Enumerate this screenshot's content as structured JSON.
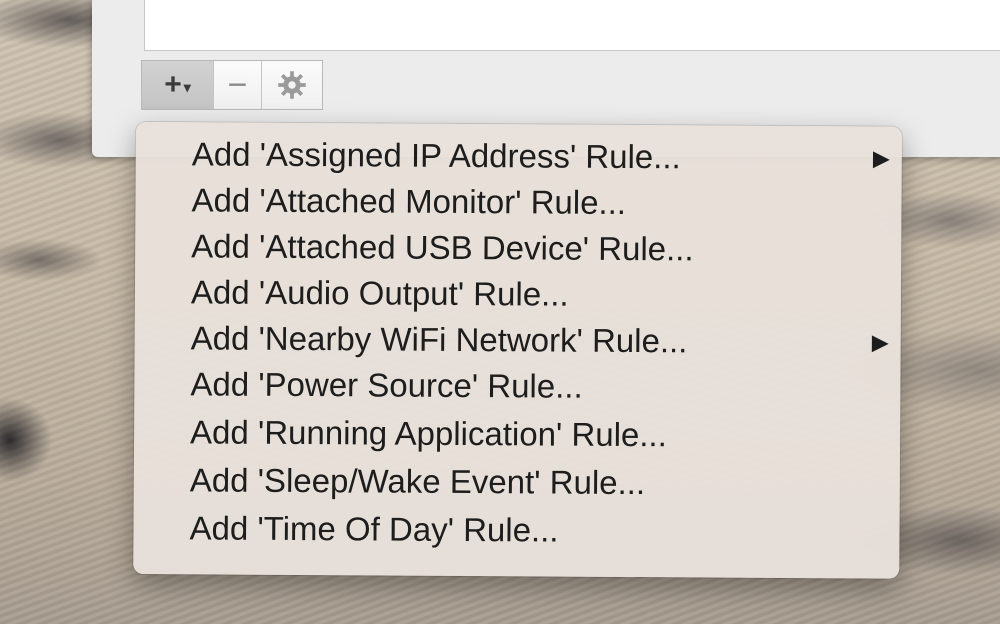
{
  "toolbar": {
    "add_label": "+",
    "add_caret": "▾",
    "remove_label": "−",
    "gear_icon": "gear-icon"
  },
  "menu": {
    "items": [
      {
        "label": "Add 'Assigned IP Address' Rule...",
        "submenu": true
      },
      {
        "label": "Add 'Attached Monitor' Rule...",
        "submenu": false
      },
      {
        "label": "Add 'Attached USB Device' Rule...",
        "submenu": false
      },
      {
        "label": "Add 'Audio Output' Rule...",
        "submenu": false
      },
      {
        "label": "Add 'Nearby WiFi Network' Rule...",
        "submenu": true
      },
      {
        "label": "Add 'Power Source' Rule...",
        "submenu": false
      },
      {
        "label": "Add 'Running Application' Rule...",
        "submenu": false
      },
      {
        "label": "Add 'Sleep/Wake Event' Rule...",
        "submenu": false
      },
      {
        "label": "Add 'Time Of Day' Rule...",
        "submenu": false
      }
    ],
    "submenu_arrow": "▶"
  }
}
